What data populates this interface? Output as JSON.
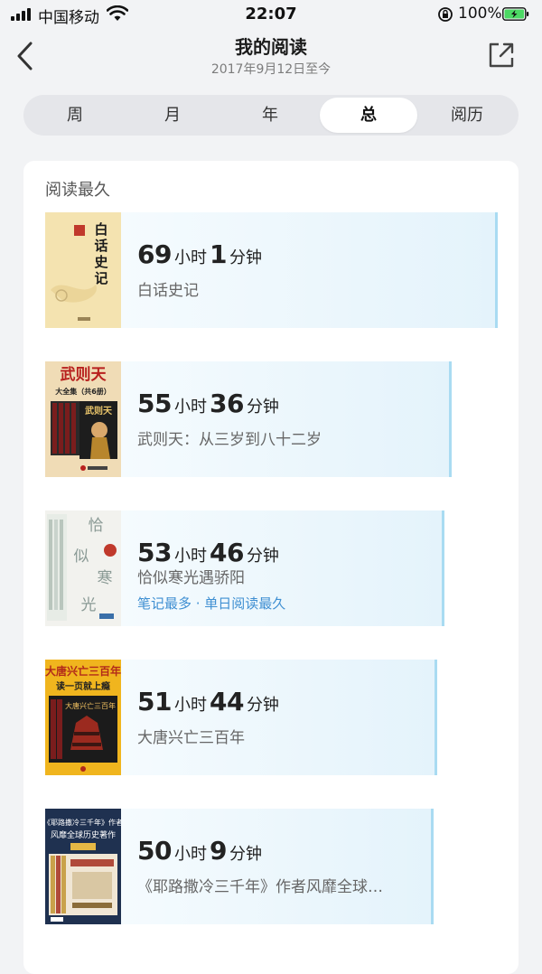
{
  "status_bar": {
    "carrier": "中国移动",
    "time": "22:07",
    "battery": "100%"
  },
  "header": {
    "title": "我的阅读",
    "subtitle": "2017年9月12日至今",
    "back_icon": "chevron-left-icon",
    "share_icon": "share-icon"
  },
  "tabs": [
    {
      "label": "周",
      "active": false
    },
    {
      "label": "月",
      "active": false
    },
    {
      "label": "年",
      "active": false
    },
    {
      "label": "总",
      "active": true
    },
    {
      "label": "阅历",
      "active": false
    }
  ],
  "section": {
    "title": "阅读最久",
    "hour_unit": "小时",
    "minute_unit": "分钟"
  },
  "books": [
    {
      "hours": "69",
      "minutes": "1",
      "name": "白话史记",
      "tag": "",
      "relative_time": 1.0
    },
    {
      "hours": "55",
      "minutes": "36",
      "name": "武则天：从三岁到八十二岁",
      "tag": "",
      "relative_time": 0.8
    },
    {
      "hours": "53",
      "minutes": "46",
      "name": "恰似寒光遇骄阳",
      "tag": "笔记最多 · 单日阅读最久",
      "relative_time": 0.77
    },
    {
      "hours": "51",
      "minutes": "44",
      "name": "大唐兴亡三百年",
      "tag": "",
      "relative_time": 0.74
    },
    {
      "hours": "50",
      "minutes": "9",
      "name": "《耶路撒冷三千年》作者风靡全球…",
      "tag": "",
      "relative_time": 0.72
    }
  ],
  "covers": {
    "cover1": {
      "title": "白话史记",
      "bg": "#f4e3b0"
    },
    "cover2": {
      "title": "武则天",
      "subtitle": "大全集（共6册）",
      "bg": "#f0dcb6",
      "accent": "#b8201e"
    },
    "cover3": {
      "title": "恰似寒光",
      "bg": "#f2f2ee",
      "accent": "#c0392b"
    },
    "cover4": {
      "title": "大唐兴亡三百年",
      "subtitle": "读一页就上瘾",
      "bg": "#f0b51e",
      "accent": "#b22a1a"
    },
    "cover5": {
      "title": "《耶路撒冷三千年》作者",
      "subtitle": "风靡全球历史著作",
      "bg": "#1f3150"
    }
  }
}
